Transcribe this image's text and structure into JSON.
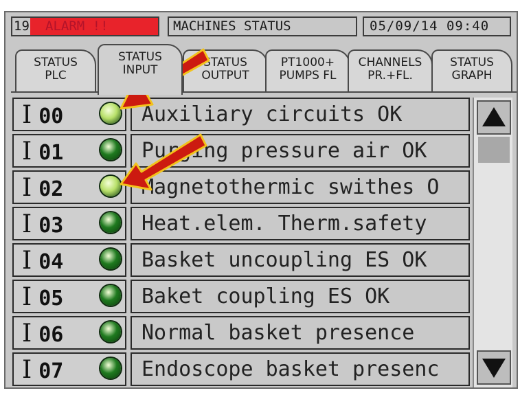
{
  "header": {
    "alarm_id": "19",
    "alarm_label": "ALARM !!",
    "title": "MACHINES STATUS",
    "datetime": "05/09/14  09:40"
  },
  "tabs": [
    {
      "label": "STATUS\nPLC",
      "active": false
    },
    {
      "label": "STATUS\nINPUT",
      "active": true
    },
    {
      "label": "STATUS\nOUTPUT",
      "active": false
    },
    {
      "label": "PT1000+\nPUMPS FL",
      "active": false
    },
    {
      "label": "CHANNELS\nPR.+FL.",
      "active": false
    },
    {
      "label": "STATUS\nGRAPH",
      "active": false
    }
  ],
  "inputs": [
    {
      "prefix": "I",
      "num": "00",
      "label": "Auxiliary circuits OK",
      "led_state": "light"
    },
    {
      "prefix": "I",
      "num": "01",
      "label": "Purging pressure air OK",
      "led_state": "dark"
    },
    {
      "prefix": "I",
      "num": "02",
      "label": "Magnetothermic swithes O",
      "led_state": "light"
    },
    {
      "prefix": "I",
      "num": "03",
      "label": "Heat.elem. Therm.safety",
      "led_state": "dark"
    },
    {
      "prefix": "I",
      "num": "04",
      "label": "Basket uncoupling ES OK",
      "led_state": "dark"
    },
    {
      "prefix": "I",
      "num": "05",
      "label": "Baket coupling ES OK",
      "led_state": "dark"
    },
    {
      "prefix": "I",
      "num": "06",
      "label": "Normal basket presence",
      "led_state": "dark"
    },
    {
      "prefix": "I",
      "num": "07",
      "label": "Endoscope basket presenc",
      "led_state": "dark"
    }
  ],
  "colors": {
    "led_light": "#b8e06a",
    "led_dark": "#1f7a1f",
    "alarm_bg": "#e8232b",
    "annotation_arrow": "#cc1a10",
    "annotation_outline": "#f2c21b"
  },
  "icons": {
    "scroll_up": "up-triangle-icon",
    "scroll_down": "down-triangle-icon",
    "annotation": "red-arrow-icon"
  }
}
